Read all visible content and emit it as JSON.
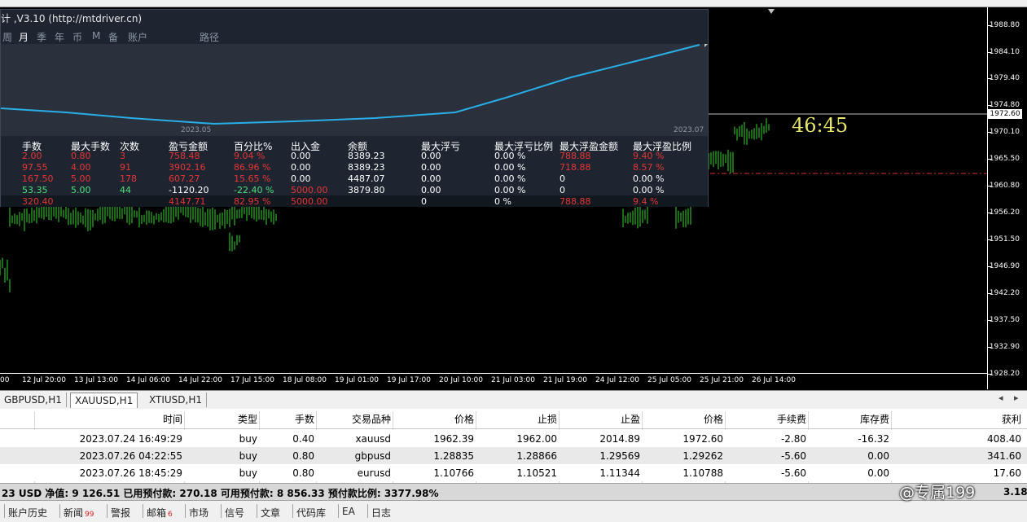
{
  "panel": {
    "title": "计 ,V3.10 (http://mtdriver.cn)",
    "tabs": [
      "周",
      "月",
      "季",
      "年",
      "币",
      "M",
      "备",
      "账户",
      "路径"
    ],
    "graph_dates": [
      "2023.05",
      "2023.07"
    ],
    "headers": [
      "手数",
      "最大手数",
      "次数",
      "盈亏金额",
      "百分比%",
      "出入金",
      "余额",
      "最大浮亏",
      "最大浮亏比例",
      "最大浮盈金额",
      "最大浮盈比例"
    ],
    "rows": [
      [
        "2.00",
        "0.80",
        "3",
        "758.48",
        "9.04 %",
        "0.00",
        "8389.23",
        "0.00",
        "0.00 %",
        "788.88",
        "9.40 %"
      ],
      [
        "97.55",
        "4.00",
        "91",
        "3902.16",
        "86.96 %",
        "0.00",
        "8389.23",
        "0.00",
        "0.00 %",
        "718.88",
        "8.57 %"
      ],
      [
        "167.50",
        "5.00",
        "178",
        "607.27",
        "15.65 %",
        "0.00",
        "4487.07",
        "0.00",
        "0.00 %",
        "0",
        "0.00 %"
      ],
      [
        "53.35",
        "5.00",
        "44",
        "-1120.20",
        "-22.40 %",
        "5000.00",
        "3879.80",
        "0.00",
        "0.00 %",
        "0",
        "0.00 %"
      ]
    ],
    "total": [
      "320.40",
      "",
      "",
      "4147.71",
      "82.95 %",
      "5000.00",
      "",
      "0",
      "0 %",
      "788.88",
      "9.4 %"
    ]
  },
  "chart": {
    "timer": "46:45",
    "current_price": "1972.60",
    "price_ticks": [
      "1988.80",
      "1984.10",
      "1979.40",
      "1974.80",
      "1970.10",
      "1965.50",
      "1960.80",
      "1956.20",
      "1951.50",
      "1946.90",
      "1942.20",
      "1937.50",
      "1932.90",
      "1928.20"
    ],
    "time_ticks": [
      "00",
      "12 Jul 20:00",
      "13 Jul 13:00",
      "14 Jul 06:00",
      "14 Jul 22:00",
      "17 Jul 15:00",
      "18 Jul 08:00",
      "19 Jul 01:00",
      "19 Jul 17:00",
      "20 Jul 10:00",
      "21 Jul 03:00",
      "21 Jul 19:00",
      "24 Jul 12:00",
      "25 Jul 05:00",
      "25 Jul 21:00",
      "26 Jul 14:00"
    ]
  },
  "symbol_tabs": [
    "GBPUSD,H1",
    "XAUUSD,H1",
    "XTIUSD,H1"
  ],
  "orders": {
    "headers": [
      "时间",
      "类型",
      "手数",
      "交易品种",
      "价格",
      "止损",
      "止盈",
      "价格",
      "手续费",
      "库存费",
      "获利"
    ],
    "rows": [
      [
        "2023.07.24 16:49:29",
        "buy",
        "0.40",
        "xauusd",
        "1962.39",
        "1962.00",
        "2014.89",
        "1972.60",
        "-2.80",
        "-16.32",
        "408.40"
      ],
      [
        "2023.07.26 04:22:55",
        "buy",
        "0.80",
        "gbpusd",
        "1.28835",
        "1.28866",
        "1.29569",
        "1.29262",
        "-5.60",
        "0.00",
        "341.60"
      ],
      [
        "2023.07.26 18:45:29",
        "buy",
        "0.80",
        "eurusd",
        "1.10766",
        "1.10521",
        "1.11344",
        "1.10788",
        "-5.60",
        "0.00",
        "17.60"
      ]
    ]
  },
  "summary": {
    "text": "23 USD  净值: 9 126.51  已用预付款: 270.18  可用预付款: 8 856.33  预付款比例: 3377.98%",
    "right": "3.18"
  },
  "bottom_tabs": [
    {
      "label": "账户历史",
      "badge": ""
    },
    {
      "label": "新闻",
      "badge": "99"
    },
    {
      "label": "警报",
      "badge": ""
    },
    {
      "label": "邮箱",
      "badge": "6"
    },
    {
      "label": "市场",
      "badge": ""
    },
    {
      "label": "信号",
      "badge": ""
    },
    {
      "label": "文章",
      "badge": ""
    },
    {
      "label": "代码库",
      "badge": ""
    },
    {
      "label": "EA",
      "badge": ""
    },
    {
      "label": "日志",
      "badge": ""
    }
  ],
  "watermark": "@专属199",
  "colors": {
    "candle": "#35d82e",
    "graph_line": "#29aee8",
    "panel_bg": "#1e2530",
    "timer": "#e7e76c",
    "level_line": "#e03030"
  }
}
